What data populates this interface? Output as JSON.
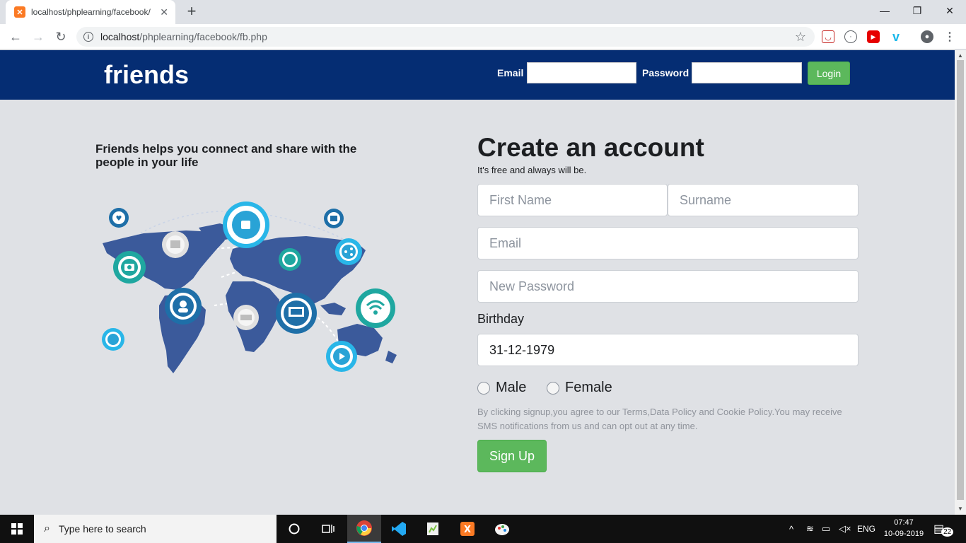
{
  "browser": {
    "tab_title": "localhost/phplearning/facebook/",
    "tab_favicon": "xampp-icon",
    "url_host": "localhost",
    "url_path": "/phplearning/facebook/fb.php"
  },
  "header": {
    "logo": "friends",
    "email_label": "Email",
    "password_label": "Password",
    "login_label": "Login"
  },
  "intro": {
    "tagline": "Friends helps you connect and share with the people in your life",
    "map_icons": [
      "heart-icon",
      "thumbs-up-icon",
      "mail-icon",
      "image-icon",
      "share-icon",
      "camera-icon",
      "cloud-icon",
      "headset-icon",
      "wifi-icon",
      "chat-icon",
      "monitor-icon",
      "user-icon",
      "video-icon"
    ]
  },
  "form": {
    "title": "Create an account",
    "subtitle": "It's free and always will be.",
    "first_name_placeholder": "First Name",
    "surname_placeholder": "Surname",
    "email_placeholder": "Email",
    "password_placeholder": "New Password",
    "birthday_label": "Birthday",
    "birthday_value": "31-12-1979",
    "gender_male": "Male",
    "gender_female": "Female",
    "terms": "By clicking signup,you agree to our Terms,Data Policy and Cookie Policy.You may receive SMS notifications from us and can opt out at any time.",
    "signup_label": "Sign Up"
  },
  "taskbar": {
    "search_placeholder": "Type here to search",
    "language": "ENG",
    "time": "07:47",
    "date": "10-09-2019",
    "notifications": "22"
  },
  "colors": {
    "header_bg": "#052d73",
    "accent_green": "#5cb85c",
    "page_bg": "#dfe1e5"
  }
}
